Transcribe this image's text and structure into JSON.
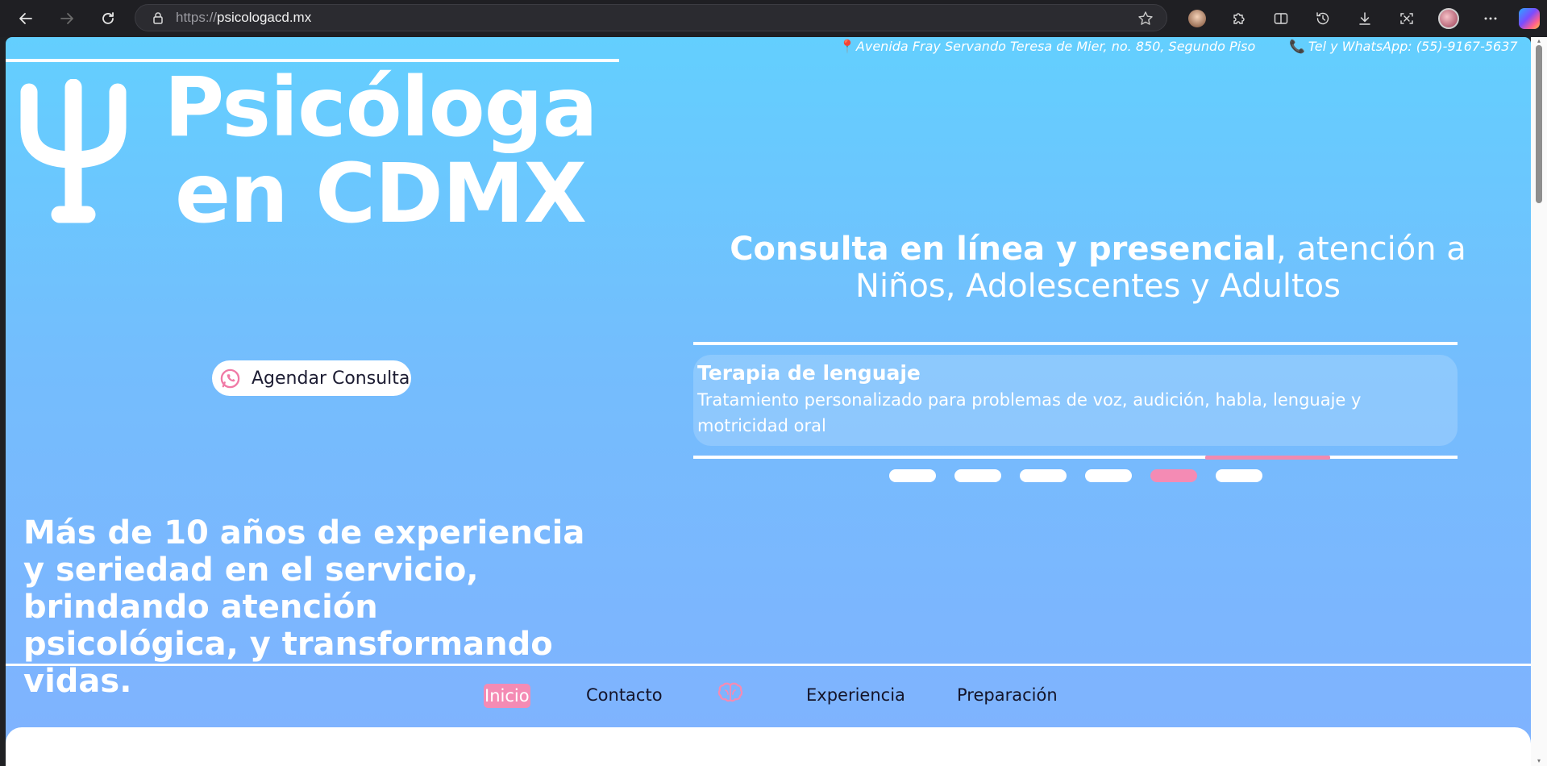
{
  "browser": {
    "url_prefix": "https://",
    "url_domain": "psicologacd.mx"
  },
  "site": {
    "address": "Avenida Fray Servando Teresa de Mier, no. 850, Segundo Piso",
    "phone": "Tel y WhatsApp: (55)-9167-5637",
    "title_line1": "Psicóloga",
    "title_line2": "en CDMX",
    "cta_label": "Agendar Consulta",
    "headline_bold": "Consulta en línea y presencial",
    "headline_rest": ", atención a Niños, Adolescentes y Adultos",
    "carousel": {
      "title": "Terapia de lenguaje",
      "description": "Tratamiento personalizado para problemas de voz, audición, habla, lenguaje y motricidad oral",
      "slide_count": 6,
      "active_slide": 5
    },
    "experience_text": "Más de 10 años de experiencia y seriedad en el servicio, brindando atención psicológica, y transformando vidas.",
    "nav": {
      "inicio": "Inicio",
      "contacto": "Contacto",
      "experiencia": "Experiencia",
      "preparacion": "Preparación"
    }
  },
  "colors": {
    "accent_pink": "#f48bb4",
    "gradient_top": "#63cffe",
    "gradient_bottom": "#80b2fe"
  }
}
